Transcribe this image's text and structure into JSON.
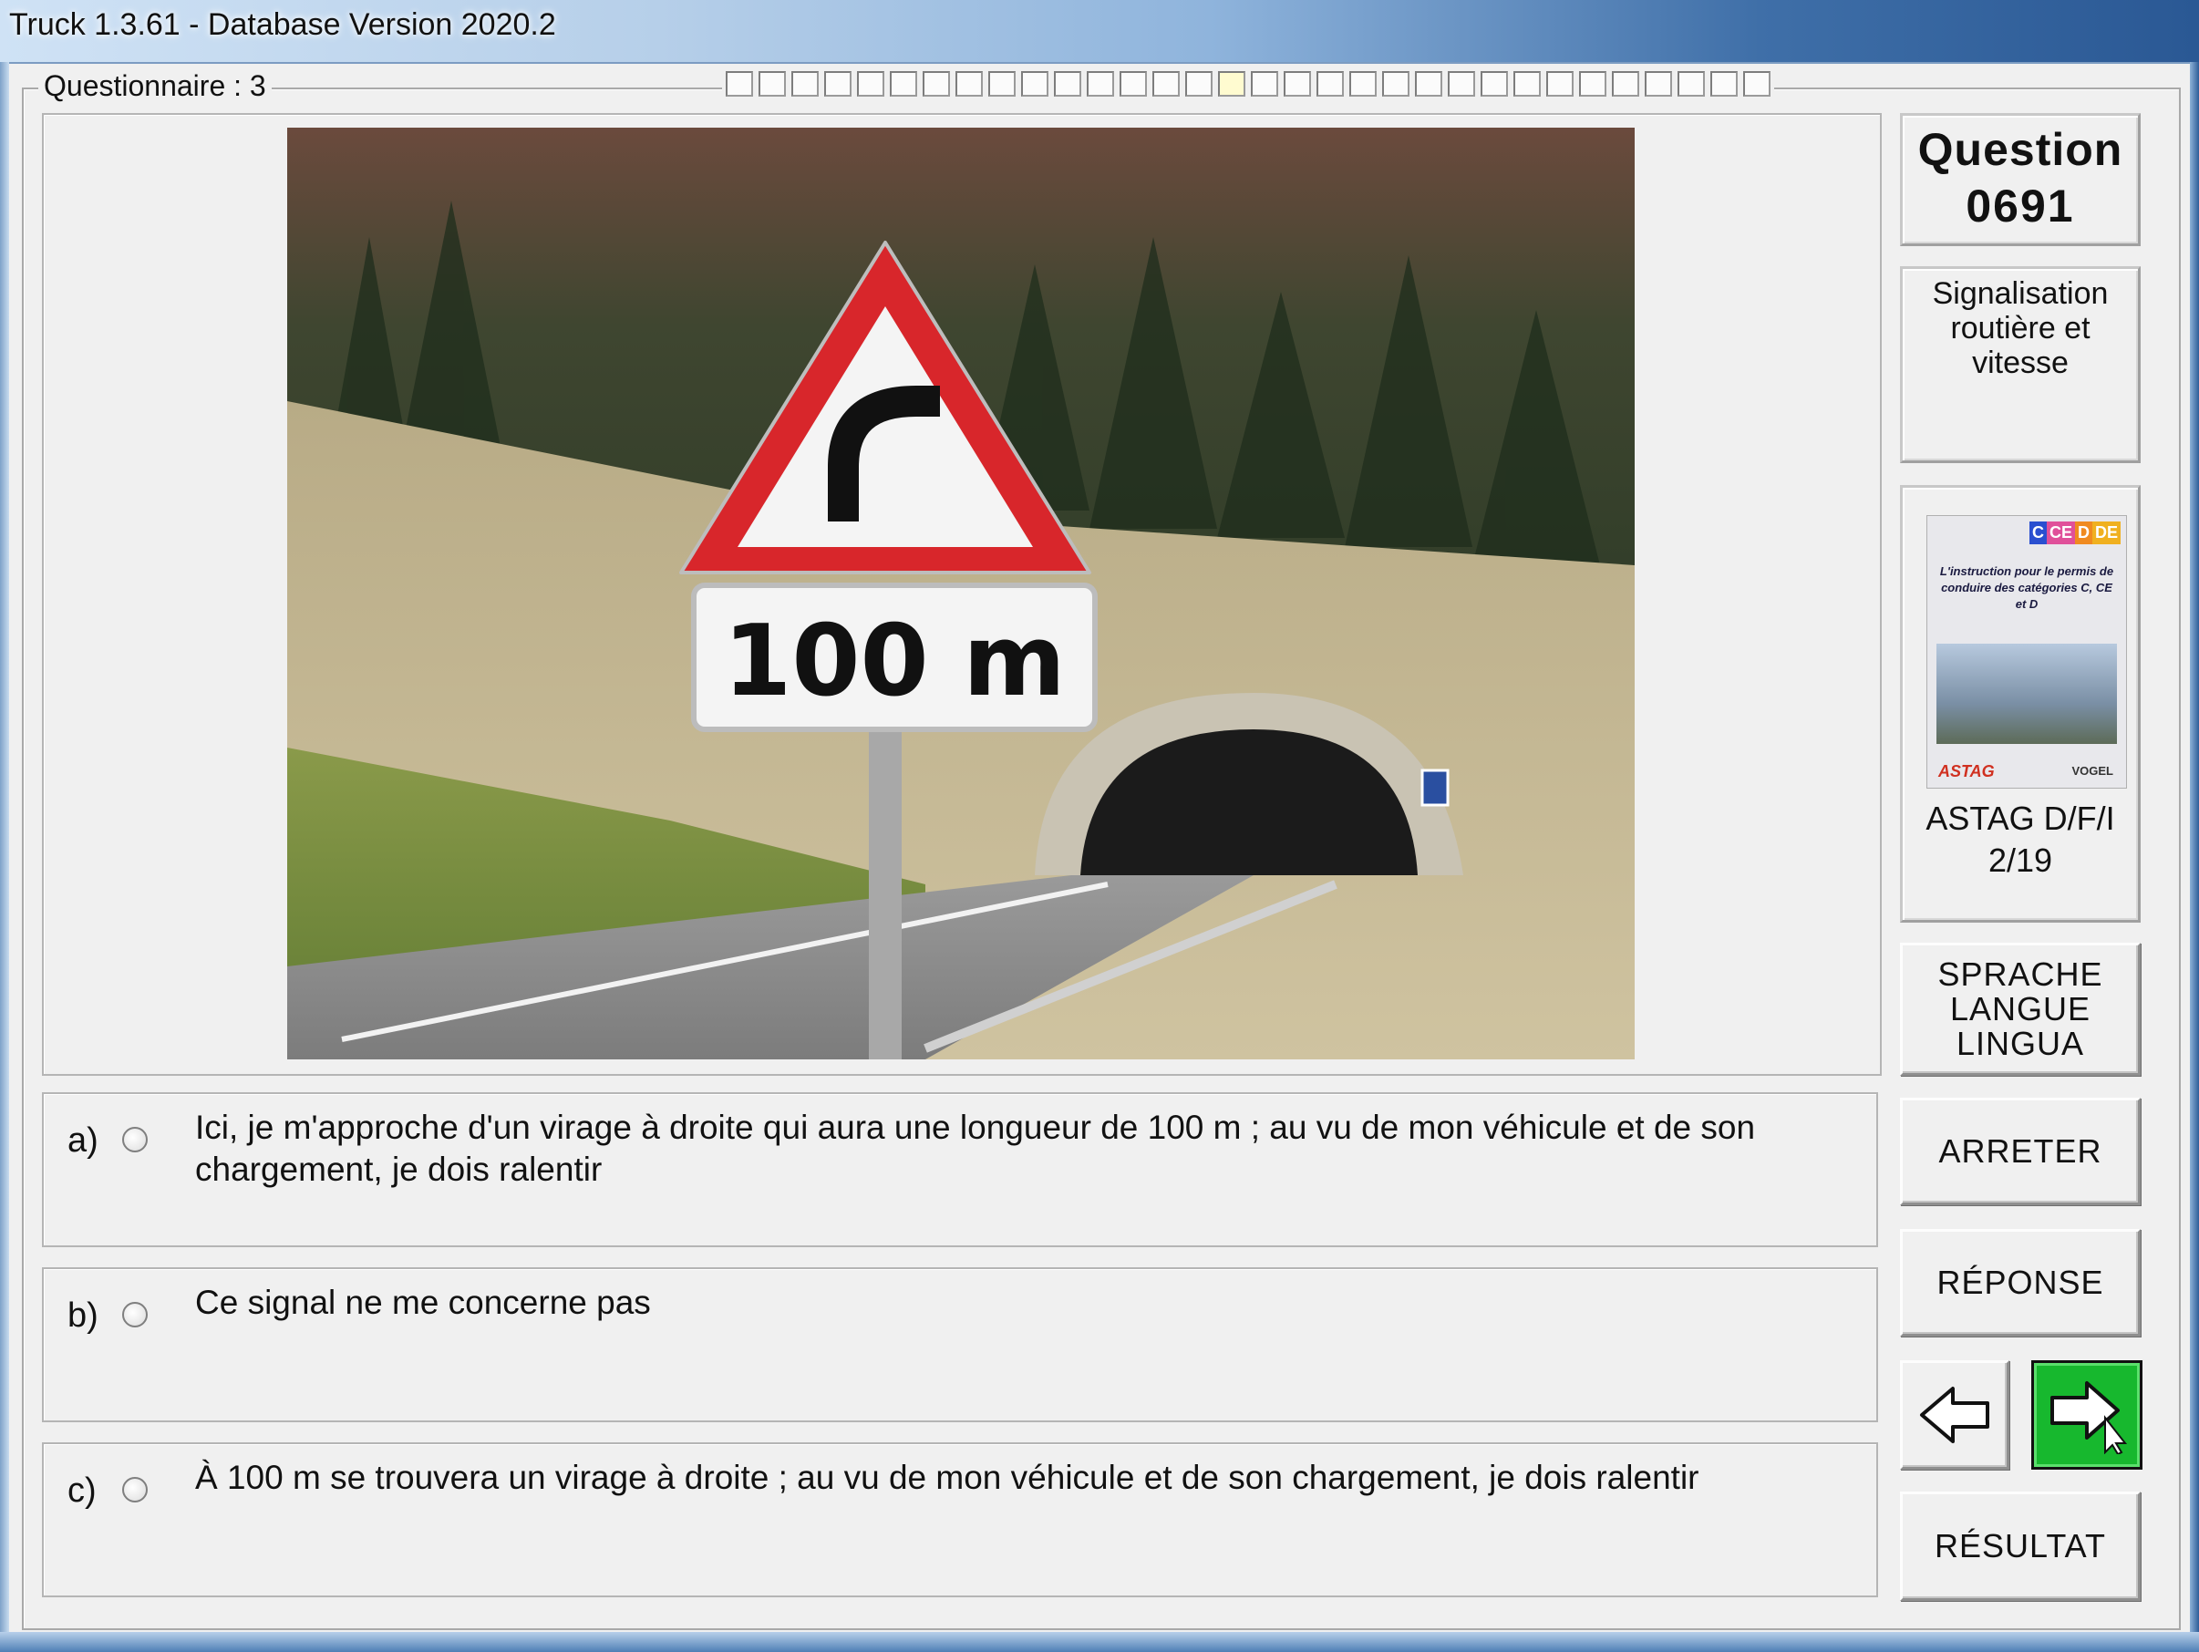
{
  "window": {
    "title": "Truck 1.3.61 - Database Version 2020.2"
  },
  "questionnaire": {
    "label": "Questionnaire : 3",
    "segments": 32,
    "current_segment": 16
  },
  "question": {
    "label": "Question",
    "number": "0691"
  },
  "category": {
    "line1": "Signalisation",
    "line2": "routière et vitesse"
  },
  "book": {
    "badges": [
      "C",
      "CE",
      "D",
      "DE"
    ],
    "cover_text": "L'instruction pour le permis de conduire des catégories C, CE et D",
    "publisher_logo": "ASTAG",
    "publisher_logo2": "VOGEL",
    "caption_line1": "ASTAG D/F/I",
    "caption_line2": "2/19"
  },
  "sign": {
    "text": "100 m"
  },
  "answers": [
    {
      "letter": "a)",
      "text": "Ici, je m'approche d'un virage à droite qui aura une longueur de 100 m ; au vu de mon véhicule et de son chargement, je dois ralentir"
    },
    {
      "letter": "b)",
      "text": "Ce signal ne me concerne pas"
    },
    {
      "letter": "c)",
      "text": "À 100 m se trouvera un virage à droite ; au vu de mon véhicule et de son chargement, je dois ralentir"
    }
  ],
  "buttons": {
    "language": [
      "SPRACHE",
      "LANGUE",
      "LINGUA"
    ],
    "stop": "ARRETER",
    "answer": "RÉPONSE",
    "result": "RÉSULTAT",
    "prev_icon": "arrow-left-icon",
    "next_icon": "arrow-right-icon"
  },
  "colors": {
    "next_button": "#17b82e",
    "sign_border": "#d8262b",
    "current_segment": "#fffbd0"
  }
}
